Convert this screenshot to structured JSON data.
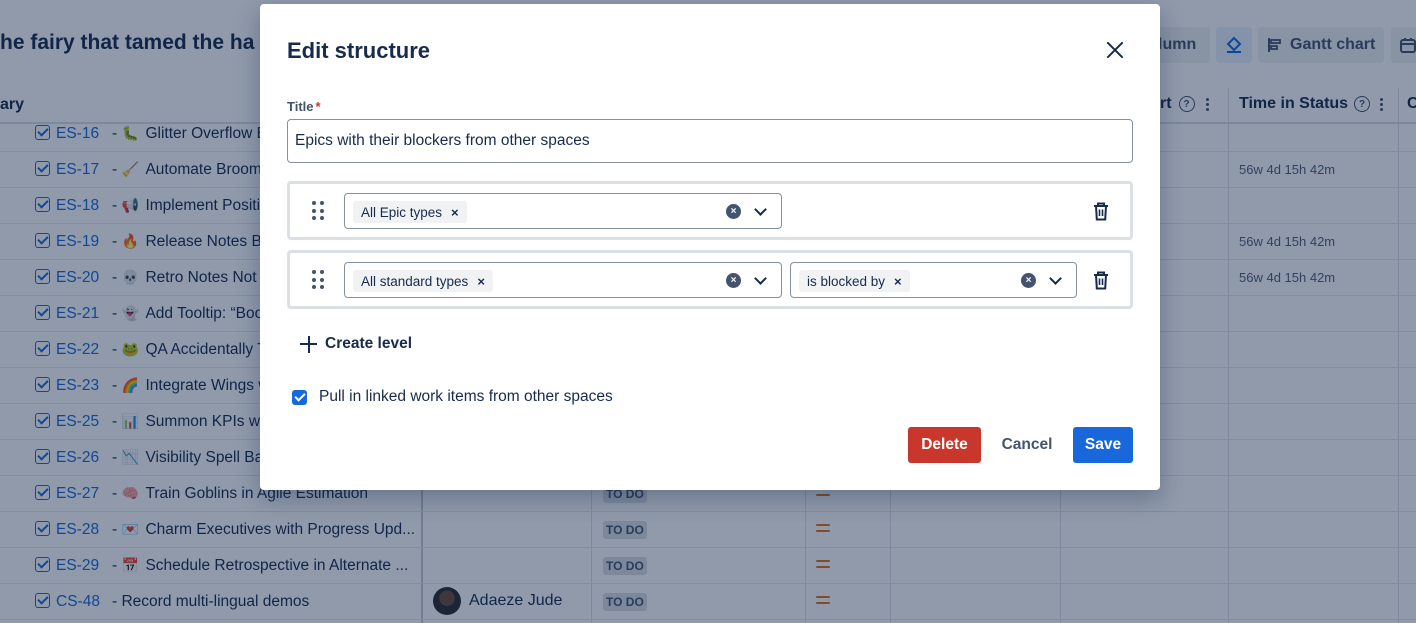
{
  "background": {
    "page_title": "he fairy that tamed the ha",
    "toolbar": {
      "column_label": "lumn",
      "gantt_label": "Gantt chart"
    },
    "table_headers": {
      "summary": "ary",
      "start": "rt",
      "time_in_status": "Time in Status",
      "next": "C"
    },
    "rows": [
      {
        "key": "ES-16",
        "sep": " - ",
        "emoji": "🐛",
        "summary": "Glitter Overflow E",
        "assignee": "",
        "status": "",
        "time_in_status": ""
      },
      {
        "key": "ES-17",
        "sep": " - ",
        "emoji": "🧹",
        "summary": "Automate Brooms",
        "assignee": "",
        "status": "",
        "time_in_status": "56w 4d 15h 42m"
      },
      {
        "key": "ES-18",
        "sep": " - ",
        "emoji": "📢",
        "summary": "Implement Positiv",
        "assignee": "",
        "status": "",
        "time_in_status": ""
      },
      {
        "key": "ES-19",
        "sep": " - ",
        "emoji": "🔥",
        "summary": "Release Notes Bu",
        "assignee": "",
        "status": "",
        "time_in_status": "56w 4d 15h 42m"
      },
      {
        "key": "ES-20",
        "sep": " - ",
        "emoji": "💀",
        "summary": "Retro Notes Not A",
        "assignee": "",
        "status": "",
        "time_in_status": "56w 4d 15h 42m"
      },
      {
        "key": "ES-21",
        "sep": " - ",
        "emoji": "👻",
        "summary": "Add Tooltip: “Boo",
        "assignee": "",
        "status": "",
        "time_in_status": ""
      },
      {
        "key": "ES-22",
        "sep": " - ",
        "emoji": "🐸",
        "summary": "QA Accidentally T",
        "assignee": "",
        "status": "",
        "time_in_status": ""
      },
      {
        "key": "ES-23",
        "sep": " - ",
        "emoji": "🌈",
        "summary": "Integrate Wings w",
        "assignee": "",
        "status": "",
        "time_in_status": ""
      },
      {
        "key": "ES-25",
        "sep": " - ",
        "emoji": "📊",
        "summary": "Summon KPIs with",
        "assignee": "",
        "status": "",
        "time_in_status": ""
      },
      {
        "key": "ES-26",
        "sep": " - ",
        "emoji": "📉",
        "summary": "Visibility Spell Bac",
        "assignee": "",
        "status": "",
        "time_in_status": ""
      },
      {
        "key": "ES-27",
        "sep": " - ",
        "emoji": "🧠",
        "summary": "Train Goblins in Agile Estimation",
        "assignee": "",
        "status": "TO DO",
        "time_in_status": ""
      },
      {
        "key": "ES-28",
        "sep": " - ",
        "emoji": "💌",
        "summary": "Charm Executives with Progress Upd...",
        "assignee": "",
        "status": "TO DO",
        "time_in_status": ""
      },
      {
        "key": "ES-29",
        "sep": " - ",
        "emoji": "📅",
        "summary": "Schedule Retrospective in Alternate ...",
        "assignee": "",
        "status": "TO DO",
        "time_in_status": ""
      },
      {
        "key": "CS-48",
        "sep": " - ",
        "emoji": "",
        "summary": "Record multi-lingual demos",
        "assignee": "Adaeze Jude",
        "status": "TO DO",
        "time_in_status": ""
      }
    ]
  },
  "modal": {
    "title": "Edit structure",
    "title_field": {
      "label": "Title",
      "required_mark": "*",
      "value": "Epics with their blockers from other spaces"
    },
    "levels": [
      {
        "type_chip": "All Epic types",
        "link_chip": null
      },
      {
        "type_chip": "All standard types",
        "link_chip": "is blocked by"
      }
    ],
    "chip_remove": "×",
    "clear_glyph": "×",
    "create_level_label": "Create level",
    "pull_linked": {
      "label": "Pull in linked work items from other spaces",
      "checked": true
    },
    "buttons": {
      "delete": "Delete",
      "cancel": "Cancel",
      "save": "Save"
    }
  },
  "colors": {
    "primary": "#1868db",
    "danger": "#c9372c",
    "priority_medium": "#e2741b"
  }
}
